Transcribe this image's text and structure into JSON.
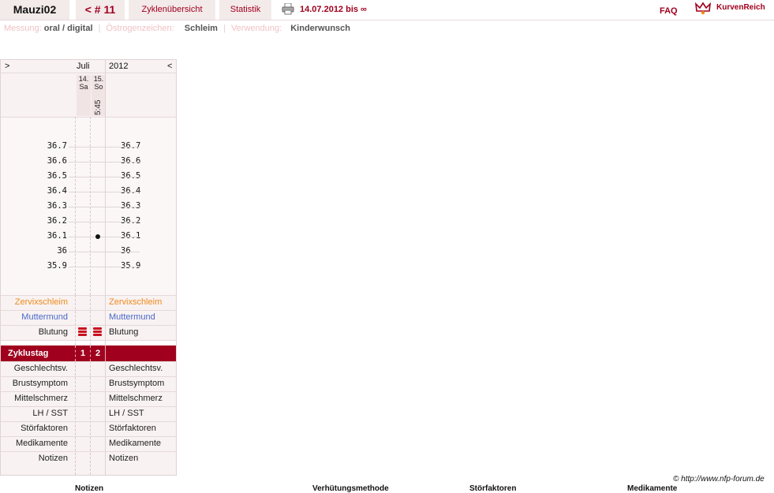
{
  "topbar": {
    "username": "Mauzi02",
    "cycle_label": "< # 11",
    "nav": [
      {
        "label": "Zyklenübersicht"
      },
      {
        "label": "Statistik"
      }
    ],
    "date_range": "14.07.2012 bis ∞",
    "faq": "FAQ",
    "logo_text": "KurvenReich"
  },
  "meta": {
    "messung_label": "Messung:",
    "messung_value": "oral / digital",
    "oestrogen_label": "Östrogenzeichen:",
    "oestrogen_value": "Schleim",
    "verwendung_label": "Verwendung:",
    "verwendung_value": "Kinderwunsch"
  },
  "chart": {
    "nav_prev": ">",
    "nav_next": "<",
    "month": "Juli",
    "year": "2012",
    "days": [
      {
        "day": "14.",
        "weekday": "Sa",
        "time": "",
        "temp": null
      },
      {
        "day": "15.",
        "weekday": "So",
        "time": "5:45",
        "temp": 36.1
      }
    ],
    "temp_scale": [
      "36.7",
      "36.6",
      "36.5",
      "36.4",
      "36.3",
      "36.2",
      "36.1",
      "36",
      "35.9"
    ],
    "rows_top": {
      "cervix": "Zervixschleim",
      "muttermund": "Muttermund",
      "blutung": "Blutung"
    },
    "zyklustag_label": "Zyklustag",
    "zyklustag_values": [
      "1",
      "2"
    ],
    "rows_bottom": [
      "Geschlechtsv.",
      "Brustsymptom",
      "Mittelschmerz",
      "LH / SST",
      "Störfaktoren",
      "Medikamente",
      "Notizen"
    ]
  },
  "footer": {
    "credit": "© http://www.nfp-forum.de"
  },
  "bottom_headers": [
    "Notizen",
    "Verhütungsmethode",
    "Störfaktoren",
    "Medikamente"
  ]
}
